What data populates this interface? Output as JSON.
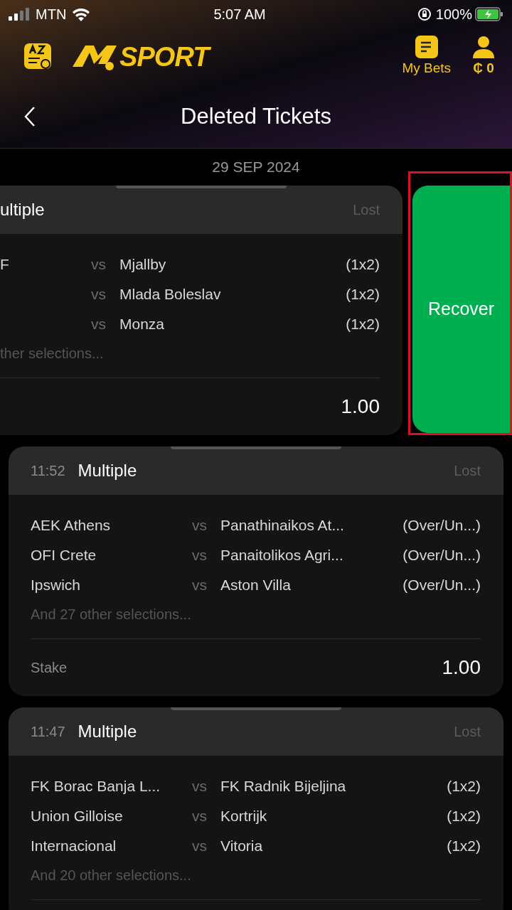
{
  "status_bar": {
    "carrier": "MTN",
    "time": "5:07 AM",
    "battery": "100%"
  },
  "app_bar": {
    "logo_text": "SPORT",
    "my_bets": "My Bets",
    "balance": "₵ 0"
  },
  "page": {
    "title": "Deleted Tickets"
  },
  "date": "29 SEP 2024",
  "tickets": [
    {
      "swiped": true,
      "title": "ultiple",
      "status": "Lost",
      "selections": [
        {
          "home": "F",
          "vs": "vs",
          "away": "Mjallby",
          "market": "(1x2)"
        },
        {
          "vs": "vs",
          "away": "Mlada Boleslav",
          "market": "(1x2)"
        },
        {
          "vs": "vs",
          "away": "Monza",
          "market": "(1x2)"
        }
      ],
      "more": "ther selections...",
      "stake": "1.00",
      "action": {
        "label": "Recover",
        "highlighted": true
      }
    },
    {
      "swiped": false,
      "time": "11:52",
      "title": "Multiple",
      "status": "Lost",
      "selections": [
        {
          "home": "AEK Athens",
          "vs": "vs",
          "away": "Panathinaikos At...",
          "market": "(Over/Un...)"
        },
        {
          "home": "OFI Crete",
          "vs": "vs",
          "away": "Panaitolikos Agri...",
          "market": "(Over/Un...)"
        },
        {
          "home": "Ipswich",
          "vs": "vs",
          "away": "Aston Villa",
          "market": "(Over/Un...)"
        }
      ],
      "more": "And 27 other selections...",
      "stake_label": "Stake",
      "stake": "1.00"
    },
    {
      "swiped": false,
      "time": "11:47",
      "title": "Multiple",
      "status": "Lost",
      "selections": [
        {
          "home": "FK Borac Banja L...",
          "vs": "vs",
          "away": "FK Radnik Bijeljina",
          "market": "(1x2)"
        },
        {
          "home": "Union Gilloise",
          "vs": "vs",
          "away": "Kortrijk",
          "market": "(1x2)"
        },
        {
          "home": "Internacional",
          "vs": "vs",
          "away": "Vitoria",
          "market": "(1x2)"
        }
      ],
      "more": "And 20 other selections..."
    }
  ]
}
